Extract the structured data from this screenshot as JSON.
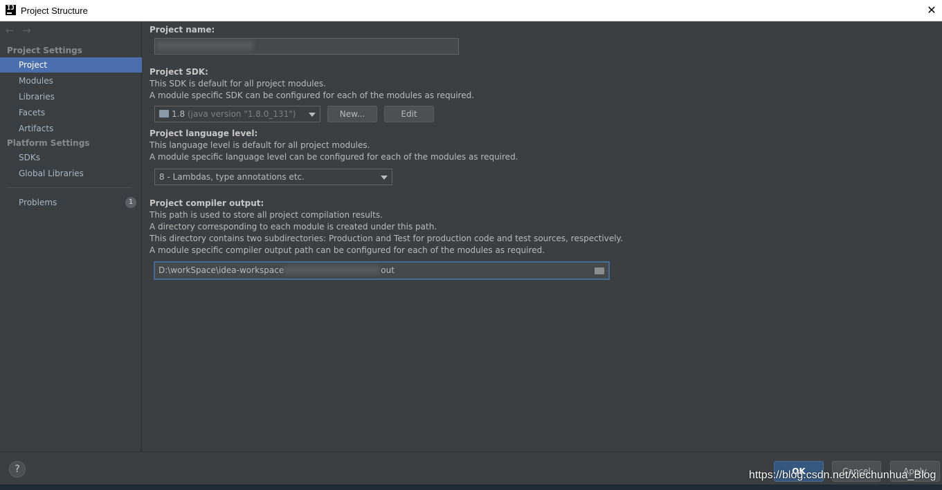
{
  "window": {
    "title": "Project Structure",
    "logo_text": "IJ",
    "close_glyph": "✕"
  },
  "sidebar": {
    "back_glyph": "←",
    "forward_glyph": "→",
    "project_settings_label": "Project Settings",
    "project_settings_items": [
      {
        "label": "Project",
        "selected": true
      },
      {
        "label": "Modules"
      },
      {
        "label": "Libraries"
      },
      {
        "label": "Facets"
      },
      {
        "label": "Artifacts"
      }
    ],
    "platform_settings_label": "Platform Settings",
    "platform_settings_items": [
      {
        "label": "SDKs"
      },
      {
        "label": "Global Libraries"
      }
    ],
    "problems": {
      "label": "Problems",
      "count": "1"
    }
  },
  "main": {
    "project_name": {
      "heading": "Project name:",
      "value": ""
    },
    "sdk": {
      "heading": "Project SDK:",
      "desc1": "This SDK is default for all project modules.",
      "desc2": "A module specific SDK can be configured for each of the modules as required.",
      "selected_name": "1.8",
      "selected_detail": "(java version \"1.8.0_131\")",
      "new_button": "New...",
      "edit_button": "Edit"
    },
    "language_level": {
      "heading": "Project language level:",
      "desc1": "This language level is default for all project modules.",
      "desc2": "A module specific language level can be configured for each of the modules as required.",
      "selected": "8 - Lambdas, type annotations etc."
    },
    "compiler_output": {
      "heading": "Project compiler output:",
      "desc1": "This path is used to store all project compilation results.",
      "desc2": "A directory corresponding to each module is created under this path.",
      "desc3": "This directory contains two subdirectories: Production and Test for production code and test sources, respectively.",
      "desc4": "A module specific compiler output path can be configured for each of the modules as required.",
      "path_prefix": "D:\\workSpace\\idea-workspace",
      "path_suffix": "out"
    }
  },
  "footer": {
    "help_glyph": "?",
    "ok": "OK",
    "cancel": "Cancel",
    "apply": "Apply"
  },
  "watermark": "https://blog.csdn.net/xiechunhua_Blog",
  "colors": {
    "background": "#3c3f41",
    "selection": "#4b6eaf",
    "focus_border": "#466d94",
    "ok_button": "#365880"
  }
}
